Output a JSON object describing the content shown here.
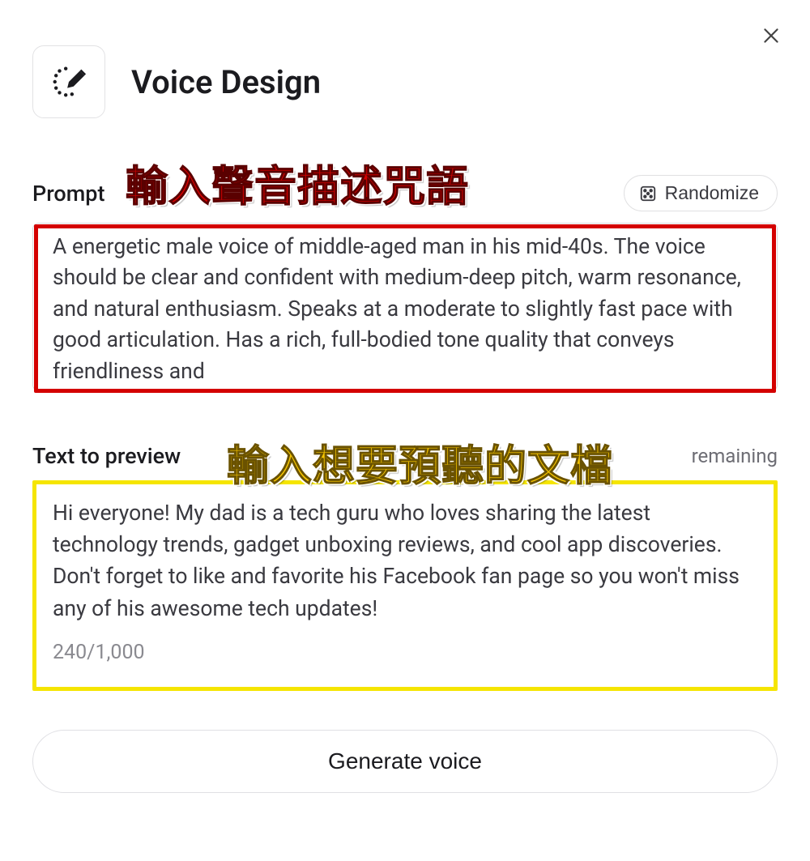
{
  "header": {
    "title": "Voice Design"
  },
  "prompt": {
    "label": "Prompt",
    "randomize_label": "Randomize",
    "randomize_label_visible_suffix": "mize",
    "value": "A energetic male voice of middle-aged man in his mid-40s. The voice should be clear and confident with medium-deep pitch, warm resonance, and natural enthusiasm. Speaks at a moderate to slightly fast pace with good articulation. Has a rich, full-bodied tone quality that conveys friendliness and"
  },
  "preview": {
    "label": "Text to preview",
    "remaining_text": "remaining",
    "remaining_text_visible_partial": "emaining",
    "value": "Hi everyone! My dad is a tech guru who loves sharing the latest technology trends, gadget unboxing reviews, and cool app discoveries. Don't forget to like and favorite his Facebook fan page so you won't miss any of his awesome tech updates!",
    "counter": "240/1,000"
  },
  "buttons": {
    "generate": "Generate voice"
  },
  "annotations": {
    "prompt_annot": "輸入聲音描述咒語",
    "preview_annot": "輸入想要預聽的文檔"
  }
}
